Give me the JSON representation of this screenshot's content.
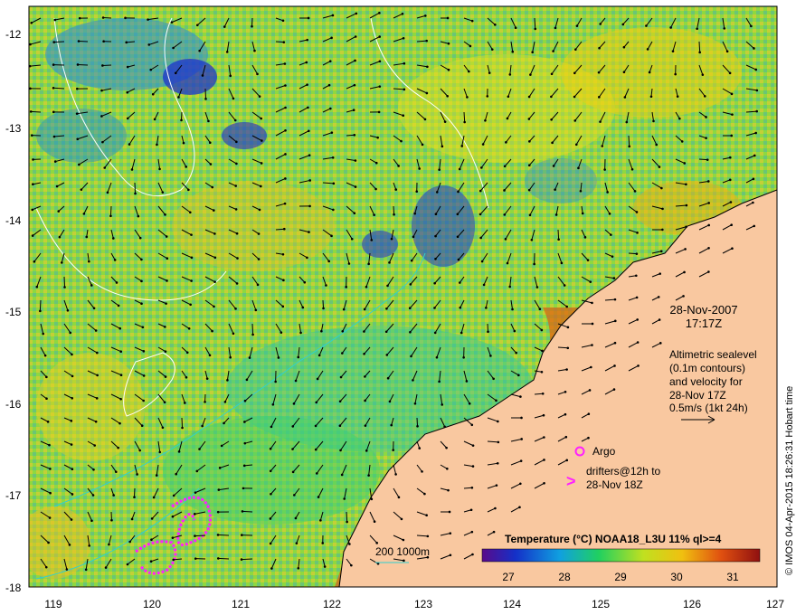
{
  "map": {
    "lat_ticks": [
      "-12",
      "-13",
      "-14",
      "-15",
      "-16",
      "-17",
      "-18"
    ],
    "lon_ticks": [
      "119",
      "120",
      "121",
      "122",
      "123",
      "124",
      "125",
      "126",
      "127"
    ],
    "date_line1": "28-Nov-2007",
    "date_line2": "17:17Z",
    "sealevel_lines": [
      "Altimetric sealevel",
      "(0.1m contours)",
      "and velocity for",
      "28-Nov 17Z",
      "0.5m/s (1kt 24h)"
    ],
    "argo_label": "Argo",
    "drifters_line1": "drifters@12h to",
    "drifters_line2": "28-Nov 18Z",
    "drifter_symbol": ">",
    "scale_label": "200  1000m",
    "colorbar_title": "Temperature (°C) NOAA18_L3U 11% ql>=4",
    "colorbar_ticks": [
      "27",
      "28",
      "29",
      "30",
      "31"
    ],
    "credit": "© IMOS 04-Apr-2015 18:26:31 Hobart time",
    "colors": {
      "land": "#f9c8a0",
      "cold": "#1836c8",
      "mid": "#38d04a",
      "warm": "#e8d020",
      "hot": "#d84808",
      "drifter": "#ff20ff",
      "isobath": "#30d0d0"
    }
  }
}
